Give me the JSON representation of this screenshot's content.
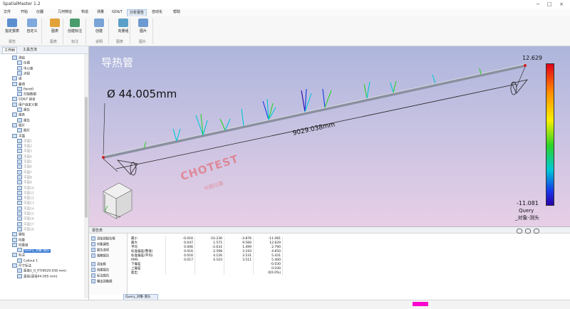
{
  "window": {
    "title": "SpatialMaster 1.2",
    "controls": [
      "−",
      "□",
      "×"
    ]
  },
  "menu": [
    "文件",
    "开始",
    "仪器",
    "几何特征",
    "构造",
    "测量",
    "GD&T",
    "分析报告",
    "自动化",
    "帮助"
  ],
  "menu_active_index": 7,
  "ribbon": {
    "buttons": [
      {
        "label": "指定报表",
        "x": 0
      },
      {
        "label": "自定义",
        "x": 1
      },
      {
        "label": "图表",
        "x": 2
      },
      {
        "label": "创建标注",
        "x": 3
      },
      {
        "label": "创建",
        "x": 4
      },
      {
        "label": "向量组",
        "x": 5
      },
      {
        "label": "图片",
        "x": 6
      }
    ],
    "groups": [
      "报告",
      "图表",
      "标注",
      "说明",
      "图表",
      "图片"
    ]
  },
  "left_panel": {
    "tabs": [
      "工作树",
      "工具方法"
    ],
    "tree": [
      {
        "label": "测站",
        "indent": 1
      },
      {
        "label": "仪器",
        "indent": 2
      },
      {
        "label": "中心库",
        "indent": 2
      },
      {
        "label": "点组",
        "indent": 2
      },
      {
        "label": "组",
        "indent": 1
      },
      {
        "label": "曲线",
        "indent": 1
      },
      {
        "label": "Point0",
        "indent": 2
      },
      {
        "label": "扫描数据",
        "indent": 2
      },
      {
        "label": "GD&T 组合",
        "indent": 1
      },
      {
        "label": "用户自定义数",
        "indent": 1
      },
      {
        "label": "报告",
        "indent": 2
      },
      {
        "label": "报表",
        "indent": 1
      },
      {
        "label": "报告",
        "indent": 2
      },
      {
        "label": "图片",
        "indent": 1
      },
      {
        "label": "图片",
        "indent": 2
      },
      {
        "label": "平面",
        "indent": 1
      },
      {
        "label": "平面1",
        "indent": 2,
        "dim": true
      },
      {
        "label": "平面2",
        "indent": 2,
        "dim": true
      },
      {
        "label": "平面3",
        "indent": 2,
        "dim": true
      },
      {
        "label": "平面4",
        "indent": 2,
        "dim": true
      },
      {
        "label": "平面5",
        "indent": 2,
        "dim": true
      },
      {
        "label": "平面6",
        "indent": 2,
        "dim": true
      },
      {
        "label": "平面7",
        "indent": 2,
        "dim": true
      },
      {
        "label": "平面8",
        "indent": 2,
        "dim": true
      },
      {
        "label": "平面9",
        "indent": 2,
        "dim": true
      },
      {
        "label": "平面10",
        "indent": 2,
        "dim": true
      },
      {
        "label": "平面11",
        "indent": 2,
        "dim": true
      },
      {
        "label": "平面12",
        "indent": 2,
        "dim": true
      },
      {
        "label": "平面13",
        "indent": 2,
        "dim": true
      },
      {
        "label": "平面14",
        "indent": 2,
        "dim": true
      },
      {
        "label": "平面15",
        "indent": 2,
        "dim": true
      },
      {
        "label": "平面16",
        "indent": 2,
        "dim": true
      },
      {
        "label": "平面17",
        "indent": 2,
        "dim": true
      },
      {
        "label": "平面18",
        "indent": 2,
        "dim": true
      },
      {
        "label": "圆柱",
        "indent": 1
      },
      {
        "label": "向量",
        "indent": 1
      },
      {
        "label": "向量组",
        "indent": 1
      },
      {
        "label": "Query_对象-测头",
        "indent": 2,
        "selected": true
      },
      {
        "label": "标注",
        "indent": 1
      },
      {
        "label": "Callout 1",
        "indent": 2
      },
      {
        "label": "尺寸标注",
        "indent": 1
      },
      {
        "label": "距离1_0_P7(9029.038 mm)",
        "indent": 2
      },
      {
        "label": "直径(直径44.005 mm)",
        "indent": 2
      }
    ]
  },
  "viewport": {
    "title": "导热管",
    "diameter": "Ø 44.005mm",
    "length": "9029.038mm",
    "scale_max": "12.629",
    "scale_min": "-11.081",
    "query": "Query",
    "query_sub": "_对象-测头",
    "watermark": "CHOTEST",
    "watermark_sub": "中图仪器",
    "colors": {
      "tube": "#9aa0ad",
      "dimension_line": "#202020"
    }
  },
  "report": {
    "title": "报告表",
    "menu": [
      "添加到报告框",
      "对象属性",
      "报告选项",
      "观察报告",
      "添加框",
      "创建报告",
      "标注报告",
      "输出到数据"
    ],
    "rows": [
      {
        "label": "最小",
        "c1": "-0.016",
        "c2": "-10.236",
        "c3": "-3.876",
        "c4": "-11.081"
      },
      {
        "label": "最大",
        "c1": "0.047",
        "c2": "1.571",
        "c3": "9.560",
        "c4": "12.629"
      },
      {
        "label": "平均",
        "c1": "0.006",
        "c2": "-2.631",
        "c3": "1.499",
        "c4": "2.790"
      },
      {
        "label": "标准偏差(整值)",
        "c1": "0.016",
        "c2": "2.598",
        "c3": "3.193",
        "c4": "4.650"
      },
      {
        "label": "标准偏差(平均)",
        "c1": "0.016",
        "c2": "4.126",
        "c3": "3.531",
        "c4": "5.431"
      },
      {
        "label": "RMS",
        "c1": "0.017",
        "c2": "4.103",
        "c3": "3.511",
        "c4": "5.400"
      },
      {
        "label": "下偏差",
        "c1": "",
        "c2": "",
        "c3": "",
        "c4": "-0.030"
      },
      {
        "label": "上偏差",
        "c1": "",
        "c2": "",
        "c3": "",
        "c4": "0.030"
      },
      {
        "label": "超出",
        "c1": "",
        "c2": "",
        "c3": "",
        "c4": "0(0.0%)"
      }
    ],
    "tab": "Query_对象-测头"
  }
}
